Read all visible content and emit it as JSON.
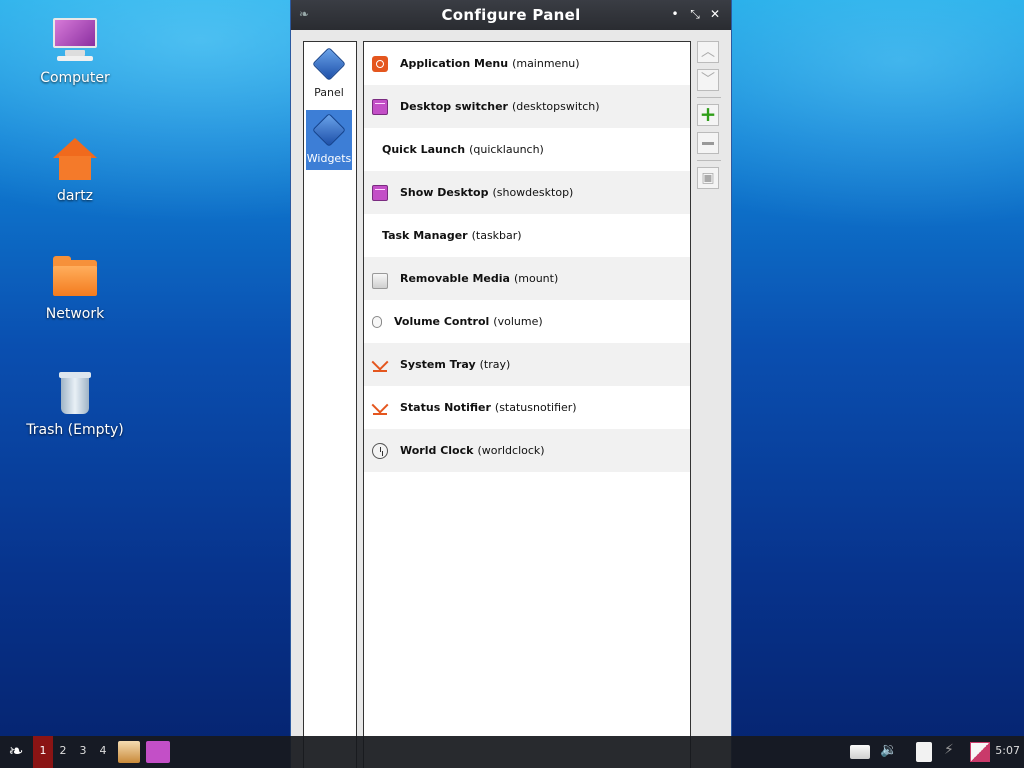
{
  "desktop": {
    "icons": [
      {
        "label": "Computer",
        "icon": "computer-icon"
      },
      {
        "label": "dartz",
        "icon": "home-folder-icon"
      },
      {
        "label": "Network",
        "icon": "network-folder-icon"
      },
      {
        "label": "Trash (Empty)",
        "icon": "trash-icon"
      }
    ]
  },
  "window": {
    "title": "Configure Panel",
    "buttons": {
      "minimize": "•",
      "maximize": "⤡",
      "close": "✕"
    },
    "sidebar": {
      "items": [
        {
          "label": "Panel",
          "selected": false
        },
        {
          "label": "Widgets",
          "selected": true
        }
      ]
    },
    "widgets": [
      {
        "name": "Application Menu",
        "id": "(mainmenu)",
        "icon": "menu"
      },
      {
        "name": "Desktop switcher",
        "id": "(desktopswitch)",
        "icon": "win"
      },
      {
        "name": "Quick Launch",
        "id": "(quicklaunch)",
        "icon": "none"
      },
      {
        "name": "Show Desktop",
        "id": "(showdesktop)",
        "icon": "win"
      },
      {
        "name": "Task Manager",
        "id": "(taskbar)",
        "icon": "none"
      },
      {
        "name": "Removable Media",
        "id": "(mount)",
        "icon": "drive"
      },
      {
        "name": "Volume Control",
        "id": "(volume)",
        "icon": "vol"
      },
      {
        "name": "System Tray",
        "id": "(tray)",
        "icon": "tray"
      },
      {
        "name": "Status Notifier",
        "id": "(statusnotifier)",
        "icon": "tray"
      },
      {
        "name": "World Clock",
        "id": "(worldclock)",
        "icon": "clock"
      }
    ],
    "toolbar": {
      "move_up": "︿",
      "move_down": "﹀",
      "add": "+",
      "remove": "",
      "configure": "▣"
    }
  },
  "taskbar": {
    "workspaces": [
      "1",
      "2",
      "3",
      "4"
    ],
    "active_workspace": "1",
    "clock": "5:07",
    "colors": {
      "active_workspace": "#8a1414",
      "selection": "#3d7ed6"
    }
  }
}
